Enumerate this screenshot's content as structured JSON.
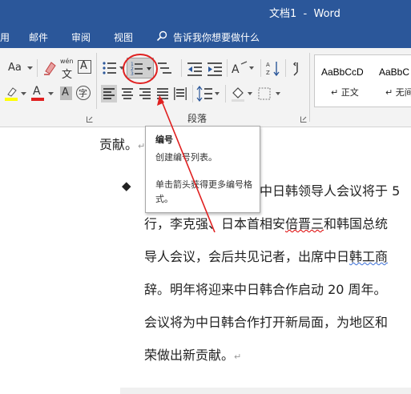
{
  "window": {
    "title": "文档1  -  Word"
  },
  "tabs": {
    "partial": "用",
    "mailings": "邮件",
    "review": "审阅",
    "view": "视图",
    "tellme_placeholder": "告诉我你想要做什么"
  },
  "ribbon": {
    "font_size_label": "Aa",
    "wen_top": "wén",
    "wen_bottom": "文",
    "char_border": "A",
    "font_color_letter": "A",
    "shading_letter": "A",
    "circle_char": "字",
    "paragraph_group_label": "段落",
    "styles": [
      {
        "sample": "AaBbCcD",
        "name": "正文"
      },
      {
        "sample": "AaBbC",
        "name": "无间"
      }
    ]
  },
  "tooltip": {
    "title": "编号",
    "description": "创建编号列表。",
    "hint": "单击箭头获得更多编号格式。"
  },
  "document": {
    "line0": "贡献。",
    "bullet": "◆",
    "para": [
      "中日韩领导人会议将于 5",
      "行，李克强、日本首相安倍晋三和韩国总统",
      "导人会议，会后共见记者，出席中日韩工商",
      "辞。明年将迎来中日韩合作启动 20 周年。",
      "会议将为中日韩合作打开新局面，为地区和",
      "荣做出新贡献。"
    ],
    "line1_seg_a": "行，李克强、日本首相安",
    "line1_seg_b": "倍晋三",
    "line1_seg_c": "和韩国总统",
    "line2_seg_a": "导人会议，会后共见记者，出席中日",
    "line2_seg_b": "韩工商"
  },
  "colors": {
    "word_blue": "#2b579a",
    "annotation_red": "#e02020",
    "ribbon_bg": "#f3f3f3"
  }
}
